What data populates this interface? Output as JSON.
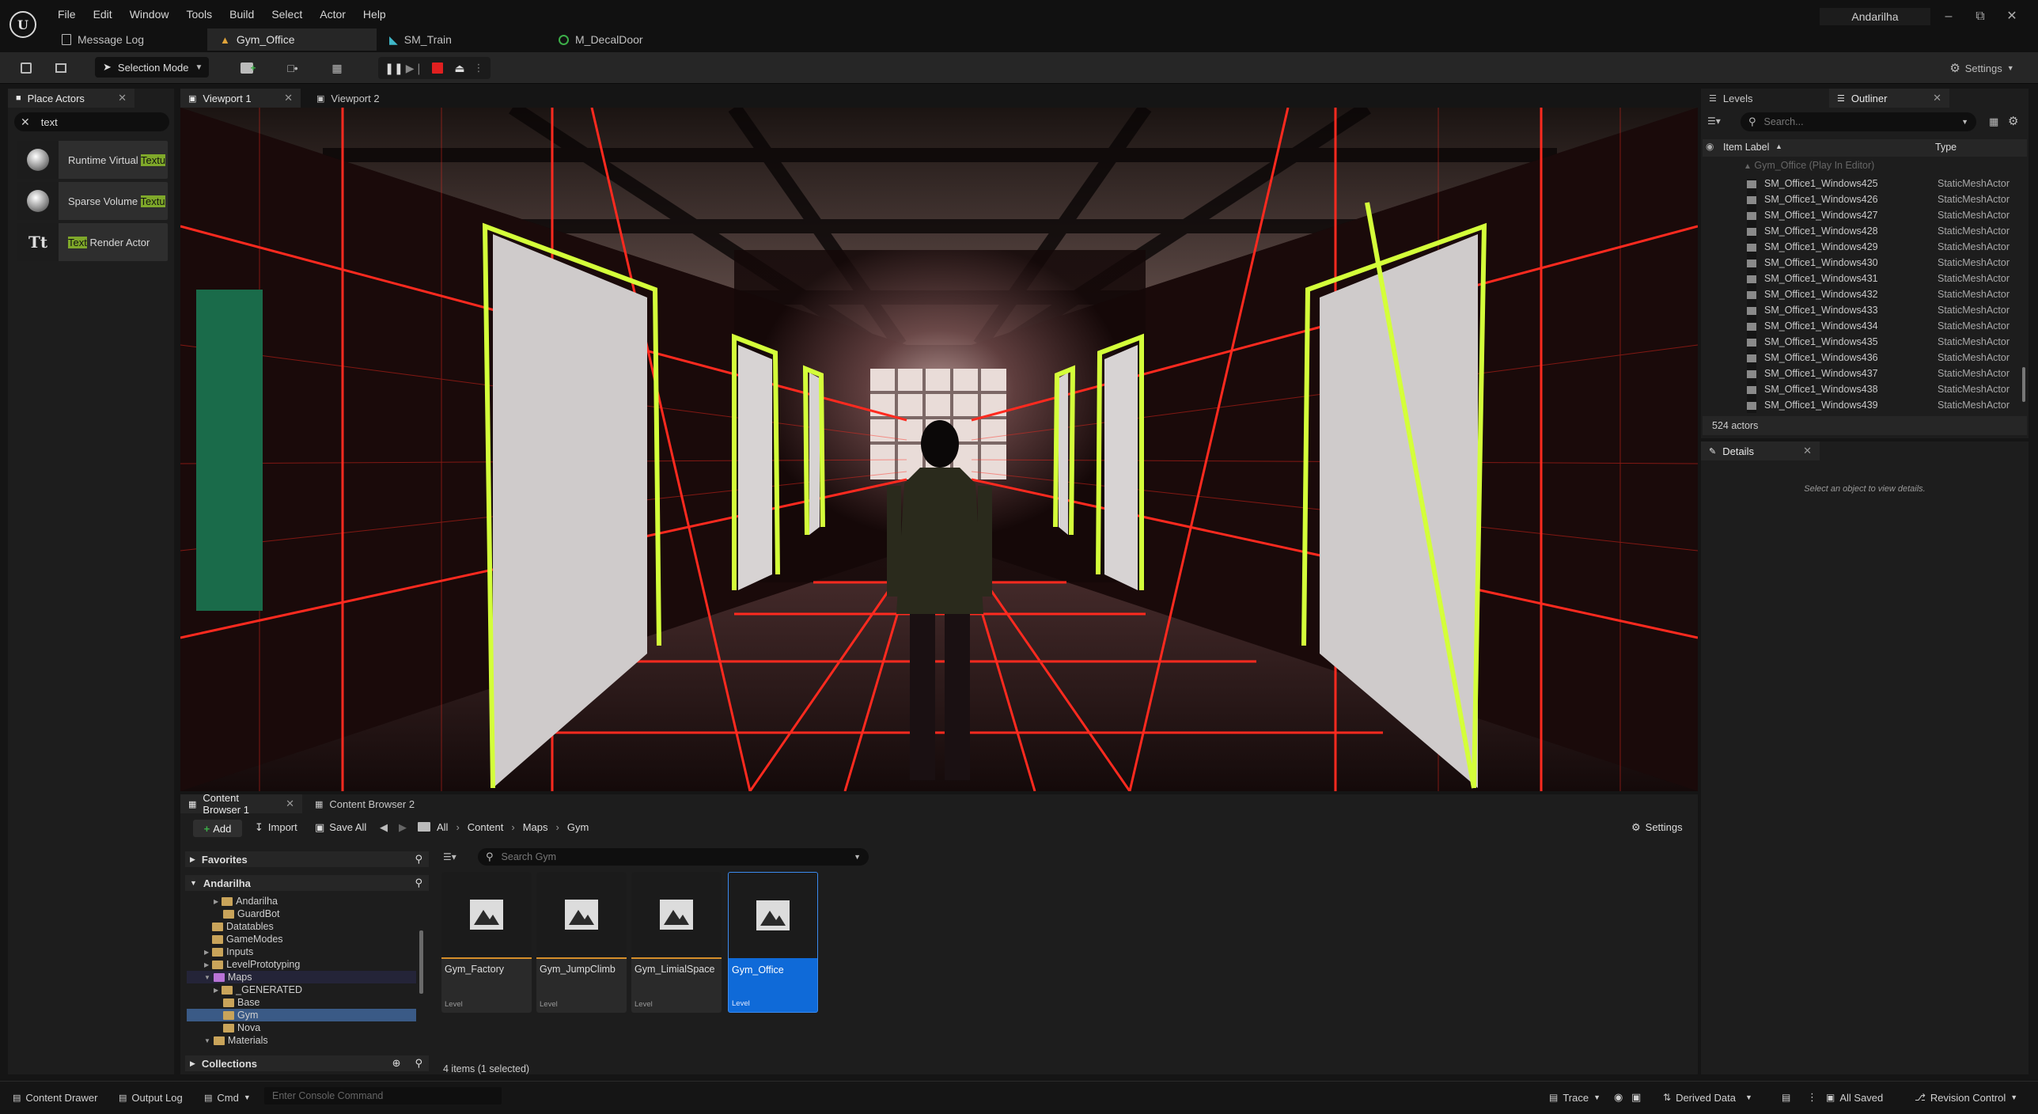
{
  "menu": [
    "File",
    "Edit",
    "Window",
    "Tools",
    "Build",
    "Select",
    "Actor",
    "Help"
  ],
  "doc_tabs": [
    {
      "label": "Message Log",
      "icon": "log-icon"
    },
    {
      "label": "Gym_Office",
      "icon": "level-icon"
    },
    {
      "label": "SM_Train",
      "icon": "mesh-icon"
    },
    {
      "label": "M_DecalDoor",
      "icon": "material-icon"
    }
  ],
  "user": "Andarilha",
  "toolbar": {
    "selection_mode": "Selection Mode",
    "settings": "Settings"
  },
  "place_actors": {
    "tab": "Place Actors",
    "search_value": "text",
    "items": [
      {
        "pre": "Runtime Virtual ",
        "hl": "Textu",
        "post": ""
      },
      {
        "pre": "Sparse Volume ",
        "hl": "Textu",
        "post": ""
      },
      {
        "pre": "",
        "hl": "Text",
        "post": " Render Actor"
      }
    ]
  },
  "viewport_tabs": [
    "Viewport 1",
    "Viewport 2"
  ],
  "outliner": {
    "tabs": [
      "Levels",
      "Outliner"
    ],
    "search_placeholder": "Search...",
    "col_label": "Item Label",
    "col_type": "Type",
    "root": "Gym_Office (Play In Editor)",
    "rows": [
      {
        "name": "SM_Office1_Windows425",
        "type": "StaticMeshActor"
      },
      {
        "name": "SM_Office1_Windows426",
        "type": "StaticMeshActor"
      },
      {
        "name": "SM_Office1_Windows427",
        "type": "StaticMeshActor"
      },
      {
        "name": "SM_Office1_Windows428",
        "type": "StaticMeshActor"
      },
      {
        "name": "SM_Office1_Windows429",
        "type": "StaticMeshActor"
      },
      {
        "name": "SM_Office1_Windows430",
        "type": "StaticMeshActor"
      },
      {
        "name": "SM_Office1_Windows431",
        "type": "StaticMeshActor"
      },
      {
        "name": "SM_Office1_Windows432",
        "type": "StaticMeshActor"
      },
      {
        "name": "SM_Office1_Windows433",
        "type": "StaticMeshActor"
      },
      {
        "name": "SM_Office1_Windows434",
        "type": "StaticMeshActor"
      },
      {
        "name": "SM_Office1_Windows435",
        "type": "StaticMeshActor"
      },
      {
        "name": "SM_Office1_Windows436",
        "type": "StaticMeshActor"
      },
      {
        "name": "SM_Office1_Windows437",
        "type": "StaticMeshActor"
      },
      {
        "name": "SM_Office1_Windows438",
        "type": "StaticMeshActor"
      },
      {
        "name": "SM_Office1_Windows439",
        "type": "StaticMeshActor"
      }
    ],
    "count": "524 actors"
  },
  "details": {
    "tab": "Details",
    "empty": "Select an object to view details."
  },
  "content_browser": {
    "tabs": [
      "Content Browser 1",
      "Content Browser 2"
    ],
    "add": "Add",
    "import": "Import",
    "save_all": "Save All",
    "breadcrumb": [
      "All",
      "Content",
      "Maps",
      "Gym"
    ],
    "settings": "Settings",
    "favorites": "Favorites",
    "project": "Andarilha",
    "folders": [
      {
        "name": "Andarilha",
        "expand": true,
        "indent": 1
      },
      {
        "name": "GuardBot",
        "expand": false,
        "indent": 1
      },
      {
        "name": "Datatables",
        "expand": false,
        "indent": 0
      },
      {
        "name": "GameModes",
        "expand": false,
        "indent": 0
      },
      {
        "name": "Inputs",
        "expand": true,
        "indent": 0
      },
      {
        "name": "LevelPrototyping",
        "expand": true,
        "indent": 0
      },
      {
        "name": "Maps",
        "expand": true,
        "indent": 0,
        "open": true
      },
      {
        "name": "_GENERATED",
        "expand": true,
        "indent": 1
      },
      {
        "name": "Base",
        "expand": false,
        "indent": 1
      },
      {
        "name": "Gym",
        "expand": false,
        "indent": 1,
        "selected": true
      },
      {
        "name": "Nova",
        "expand": false,
        "indent": 1
      },
      {
        "name": "Materials",
        "expand": true,
        "indent": 0,
        "open": true
      }
    ],
    "collections": "Collections",
    "search_placeholder": "Search Gym",
    "assets": [
      {
        "name": "Gym_Factory",
        "type": "Level"
      },
      {
        "name": "Gym_JumpClimb",
        "type": "Level"
      },
      {
        "name": "Gym_LimialSpace",
        "type": "Level"
      },
      {
        "name": "Gym_Office",
        "type": "Level",
        "selected": true
      }
    ],
    "footer": "4 items (1 selected)"
  },
  "status": {
    "content_drawer": "Content Drawer",
    "output_log": "Output Log",
    "cmd": "Cmd",
    "console_placeholder": "Enter Console Command",
    "trace": "Trace",
    "derived_data": "Derived Data",
    "all_saved": "All Saved",
    "revision_control": "Revision Control"
  },
  "colors": {
    "accent_select": "#0f6ad8",
    "highlight": "#7fa82a",
    "level_bar": "#d68f2a",
    "laser_red": "#ff2020",
    "frame_green": "#d4ff3a"
  }
}
